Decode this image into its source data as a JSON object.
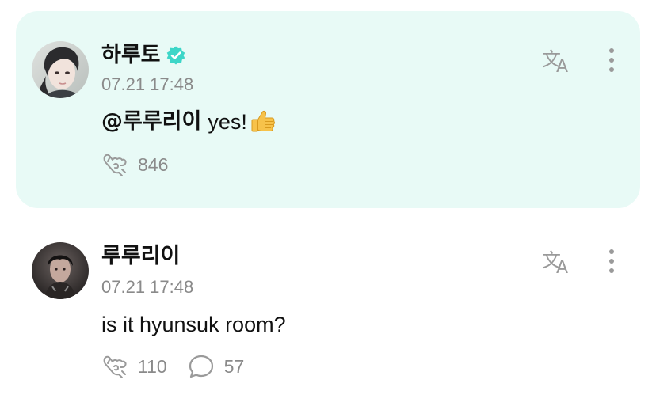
{
  "comments": [
    {
      "author": "하루토",
      "verified": true,
      "timestamp": "07.21 17:48",
      "mention": "@루루리이",
      "text": "yes!",
      "emoji": "thumbs-up",
      "likes": "846",
      "replies": null,
      "highlighted": true
    },
    {
      "author": "루루리이",
      "verified": false,
      "timestamp": "07.21 17:48",
      "mention": "",
      "text": "is it hyunsuk room?",
      "emoji": null,
      "likes": "110",
      "replies": "57",
      "highlighted": false
    }
  ],
  "icons": {
    "verified": "verified-badge-icon",
    "translate": "translate-icon",
    "more": "more-vertical-icon",
    "like": "like-hand-icon",
    "reply": "speech-bubble-icon"
  },
  "colors": {
    "highlight_bg": "#e8faf6",
    "verified": "#3dd6c8",
    "muted_text": "#8a8a8a",
    "icon_gray": "#9a9a9a"
  }
}
